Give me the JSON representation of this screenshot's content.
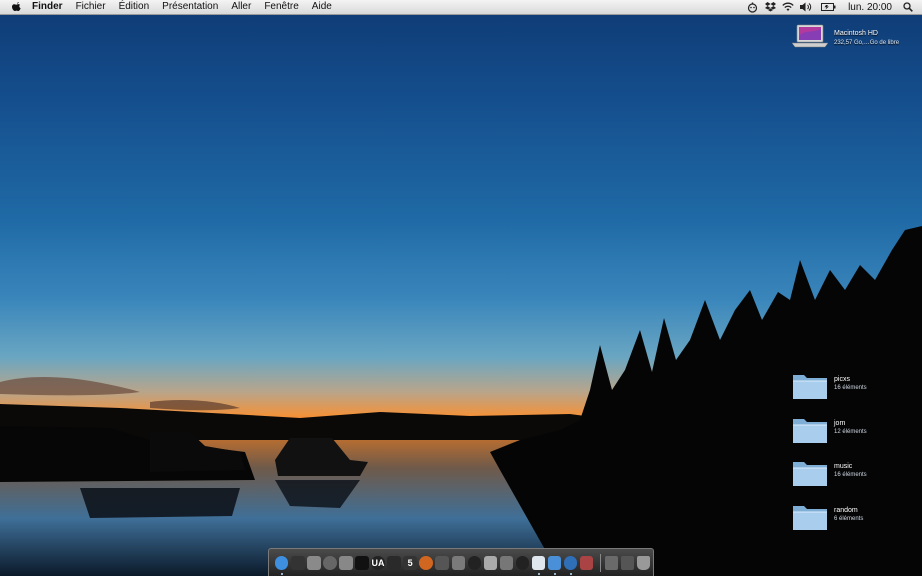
{
  "menubar": {
    "apple_icon": "apple-logo-icon",
    "items": [
      "Finder",
      "Fichier",
      "Édition",
      "Présentation",
      "Aller",
      "Fenêtre",
      "Aide"
    ],
    "status_icons": [
      "robot-icon",
      "dropbox-icon",
      "wifi-icon",
      "volume-icon",
      "battery-icon"
    ],
    "clock": "lun. 20:00",
    "search_icon": "spotlight-icon"
  },
  "desktop": {
    "drive": {
      "name": "Macintosh HD",
      "info": "232,57 Go,…Go de libre"
    },
    "folders": [
      {
        "name": "picxs",
        "count": "16 éléments"
      },
      {
        "name": "jom",
        "count": "12 éléments"
      },
      {
        "name": "music",
        "count": "16 éléments"
      },
      {
        "name": "random",
        "count": "6 éléments"
      }
    ]
  },
  "dock": {
    "items": [
      {
        "icon": "finder-icon",
        "color": "#3e8fe0",
        "glyph": "",
        "running": true
      },
      {
        "icon": "dashboard-icon",
        "color": "#333",
        "glyph": "",
        "running": false
      },
      {
        "icon": "system-preferences-icon",
        "color": "#8a8a8a",
        "glyph": "",
        "running": false
      },
      {
        "icon": "piano-icon",
        "color": "#666",
        "glyph": "",
        "running": false
      },
      {
        "icon": "compass-icon",
        "color": "#888",
        "glyph": "",
        "running": false
      },
      {
        "icon": "terminal-icon",
        "color": "#111",
        "glyph": "",
        "running": false
      },
      {
        "icon": "ua-app-icon",
        "color": "#222",
        "glyph": "UA",
        "running": false
      },
      {
        "icon": "orb-icon",
        "color": "#2a2a2a",
        "glyph": "",
        "running": false
      },
      {
        "icon": "five-app-icon",
        "color": "#333",
        "glyph": "5",
        "running": false
      },
      {
        "icon": "flame-icon",
        "color": "#d0661f",
        "glyph": "",
        "running": false
      },
      {
        "icon": "diamond-icon",
        "color": "#555",
        "glyph": "",
        "running": false
      },
      {
        "icon": "grid-app-icon",
        "color": "#7a7a7a",
        "glyph": "",
        "running": false
      },
      {
        "icon": "tetris-icon",
        "color": "#222",
        "glyph": "",
        "running": false
      },
      {
        "icon": "silver-app-icon",
        "color": "#aaa",
        "glyph": "",
        "running": false
      },
      {
        "icon": "s-app-icon",
        "color": "#777",
        "glyph": "",
        "running": false
      },
      {
        "icon": "loop-icon",
        "color": "#222",
        "glyph": "",
        "running": false
      },
      {
        "icon": "activity-icon",
        "color": "#dfe6ee",
        "glyph": "",
        "running": true
      },
      {
        "icon": "safari-icon",
        "color": "#4a90d9",
        "glyph": "",
        "running": true
      },
      {
        "icon": "globe-icon",
        "color": "#2f6fb8",
        "glyph": "",
        "running": true
      },
      {
        "icon": "chess-icon",
        "color": "#aa4444",
        "glyph": "",
        "running": false
      }
    ],
    "stack_icons": [
      "documents-stack-icon",
      "downloads-stack-icon",
      "trash-icon"
    ]
  }
}
